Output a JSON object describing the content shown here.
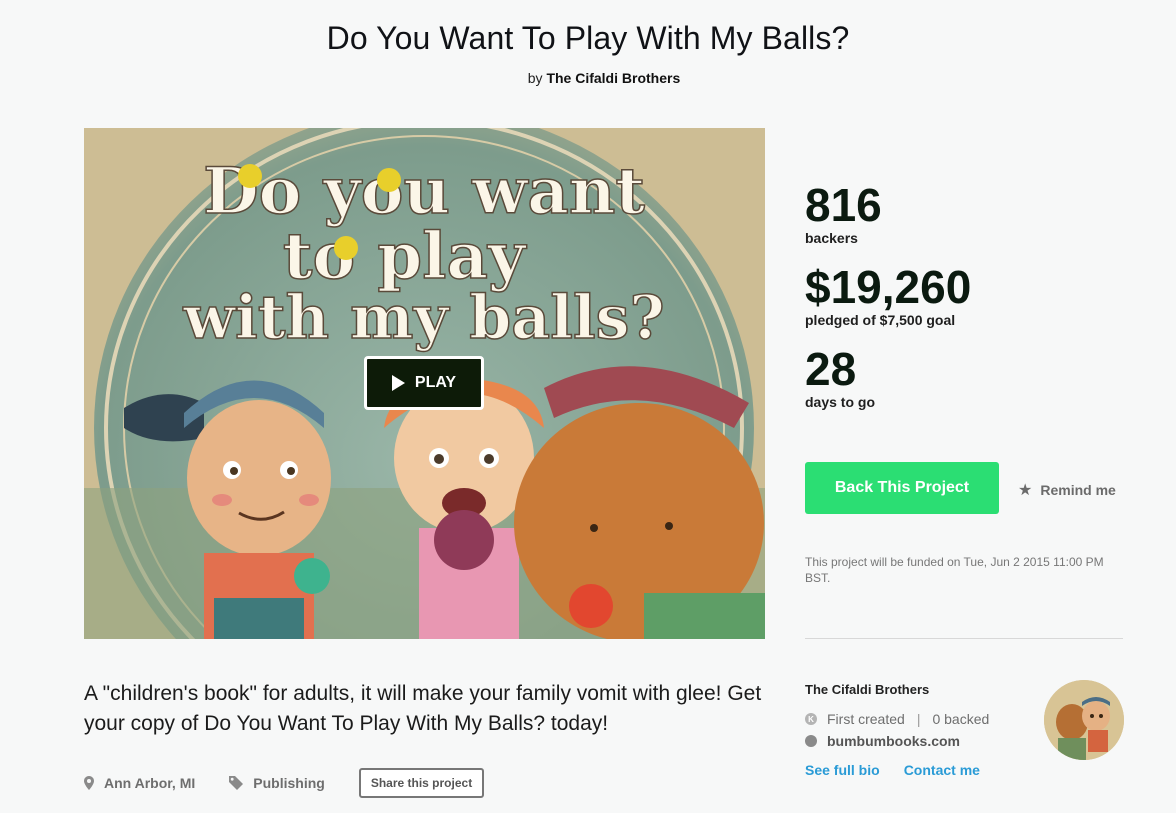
{
  "project": {
    "title": "Do You Want To Play With My Balls?",
    "by_prefix": "by",
    "creator": "The Cifaldi Brothers"
  },
  "video": {
    "cover_text_lines": [
      "Do you want",
      "to play",
      "with my balls?"
    ],
    "play_label": "PLAY"
  },
  "stats": {
    "backers": "816",
    "backers_label": "backers",
    "pledged": "$19,260",
    "pledged_label": "pledged of $7,500 goal",
    "days": "28",
    "days_label": "days to go"
  },
  "actions": {
    "back_label": "Back This Project",
    "remind_label": "Remind me"
  },
  "funded_note": "This project will be funded on Tue, Jun 2 2015 11:00 PM BST.",
  "blurb": "A \"children's book\" for adults, it will make your family vomit with glee! Get your copy of Do You Want To Play With My Balls? today!",
  "meta": {
    "location": "Ann Arbor, MI",
    "category": "Publishing",
    "share_label": "Share this project"
  },
  "creator_card": {
    "name": "The Cifaldi Brothers",
    "first_created": "First created",
    "sep": "|",
    "backed": "0 backed",
    "website": "bumbumbooks.com",
    "bio_link": "See full bio",
    "contact_link": "Contact me"
  },
  "colors": {
    "primary_green": "#2bde73",
    "link_blue": "#2a9bd6",
    "stat_text": "#0b1a10"
  }
}
